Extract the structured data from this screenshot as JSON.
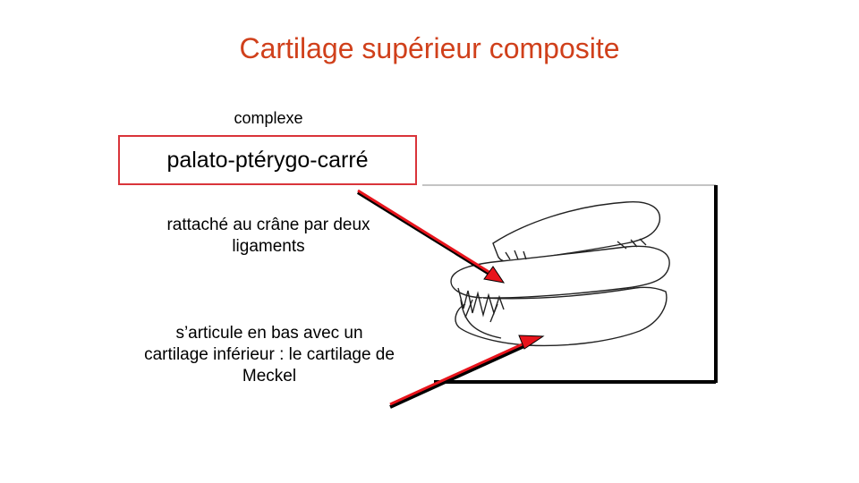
{
  "slide": {
    "title": "Cartilage supérieur composite",
    "complexe": "complexe",
    "boxed_term": "palato-ptérygo-carré",
    "ligaments_text": "rattaché au crâne par deux ligaments",
    "meckel_text": "s’articule en bas avec un cartilage inférieur : le cartilage de Meckel"
  },
  "colors": {
    "title": "#d0401b",
    "box_border": "#d9343a",
    "arrow": "#e8141c"
  }
}
